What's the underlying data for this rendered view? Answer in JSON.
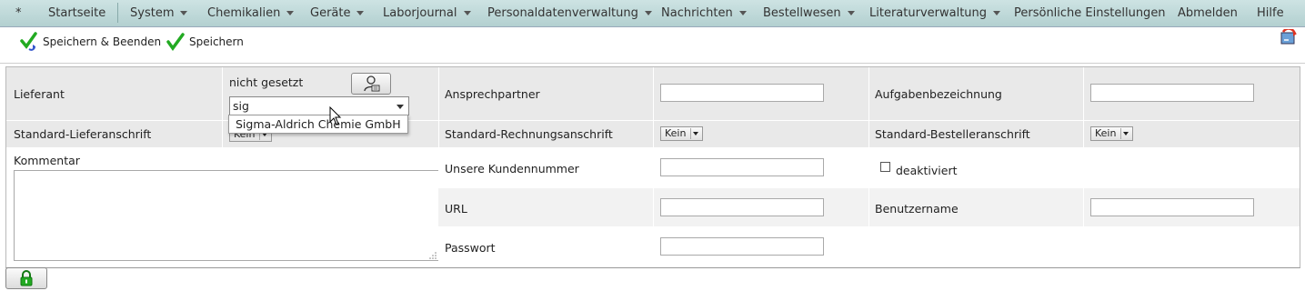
{
  "menu": {
    "star": "*",
    "items": [
      "Startseite",
      "System",
      "Chemikalien",
      "Geräte",
      "Laborjournal",
      "Personaldatenverwaltung",
      "Nachrichten",
      "Bestellwesen",
      "Literaturverwaltung",
      "Persönliche Einstellungen",
      "Abmelden",
      "Hilfe"
    ]
  },
  "toolbar": {
    "save_close": "Speichern & Beenden",
    "save": "Speichern"
  },
  "form": {
    "lieferant_label": "Lieferant",
    "lieferant_status": "nicht gesetzt",
    "lieferant_search_value": "sig",
    "lieferant_suggestion": "Sigma-Aldrich Chemie GmbH",
    "ansprechpartner_label": "Ansprechpartner",
    "aufgabe_label": "Aufgabenbezeichnung",
    "std_liefer_label": "Standard-Lieferanschrift",
    "std_liefer_value": "Kein",
    "std_rechnung_label": "Standard-Rechnungsanschrift",
    "std_rechnung_value": "Kein",
    "std_besteller_label": "Standard-Bestelleranschrift",
    "std_besteller_value": "Kein",
    "kommentar_label": "Kommentar",
    "kundennummer_label": "Unsere Kundennummer",
    "deaktiviert_label": "deaktiviert",
    "url_label": "URL",
    "benutzername_label": "Benutzername",
    "passwort_label": "Passwort"
  },
  "colors": {
    "menubar": "#bfd9d9",
    "check_green": "#22aa22"
  }
}
